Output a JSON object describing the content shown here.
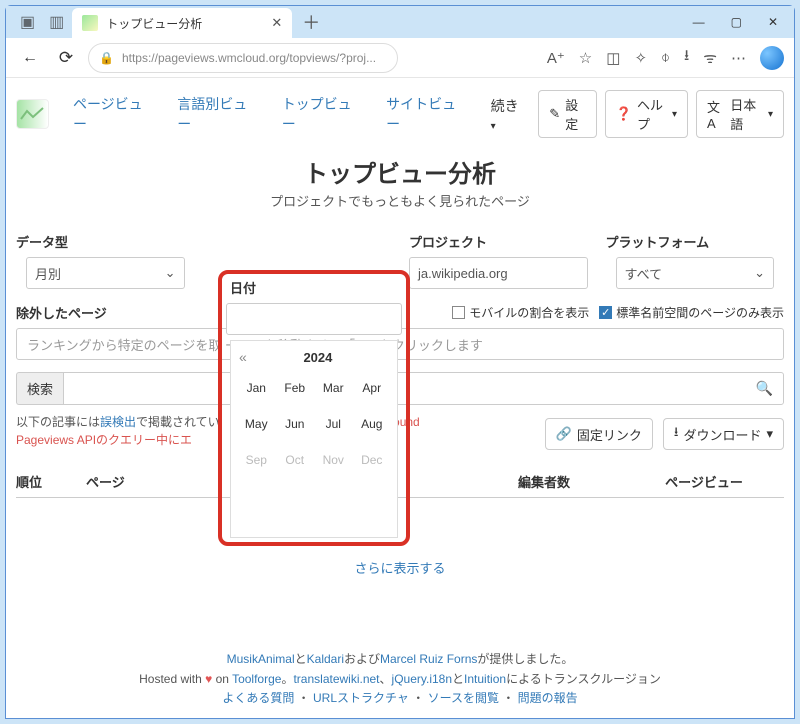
{
  "browser": {
    "tab_title": "トップビュー分析",
    "url": "https://pageviews.wmcloud.org/topviews/?proj...",
    "newtab": "＋",
    "win": {
      "min": "—",
      "max": "▢",
      "close": "✕"
    }
  },
  "nav": {
    "pageviews": "ページビュー",
    "langviews": "言語別ビュー",
    "topviews": "トップビュー",
    "siteviews": "サイトビュー",
    "continue": "続き",
    "settings": "設定",
    "help": "ヘルプ",
    "lang": "日本語"
  },
  "page": {
    "title": "トップビュー分析",
    "subtitle": "プロジェクトでもっともよく見られたページ"
  },
  "form": {
    "datatype_label": "データ型",
    "datatype_value": "月別",
    "date_label": "日付",
    "project_label": "プロジェクト",
    "project_value": "ja.wikipedia.org",
    "platform_label": "プラットフォーム",
    "platform_value": "すべて",
    "excluded_label": "除外したページ",
    "mobile_chk": "モバイルの割合を表示",
    "mainns_chk": "標準名前空間のページのみ表示",
    "excluded_placeholder": "ランキングから特定のページを取                                      ーソルを移動させて「✕」をクリックします",
    "search_label": "検索",
    "note_prefix": "以下の記事には",
    "note_link": "誤検出",
    "note_suffix_1": "で掲載されてい",
    "note_suffix_2": "ound",
    "error": "Pageviews APIのクエリー中にエ",
    "perm": "固定リンク",
    "download": "ダウンロード"
  },
  "table": {
    "rank": "順位",
    "page": "ページ",
    "editors": "編集者数",
    "views": "ページビュー",
    "more": "さらに表示する"
  },
  "datepicker": {
    "year": "2024",
    "months_enabled": [
      "Jan",
      "Feb",
      "Mar",
      "Apr",
      "May",
      "Jun",
      "Jul",
      "Aug"
    ],
    "months_disabled": [
      "Sep",
      "Oct",
      "Nov",
      "Dec"
    ]
  },
  "footer": {
    "l1a": "MusikAnimal",
    "l1b": "と",
    "l1c": "Kaldari",
    "l1d": "および",
    "l1e": "Marcel Ruiz Forns",
    "l1f": "が提供しました。",
    "l2a": "Hosted with ",
    "l2b": " on ",
    "l2c": "Toolforge",
    "l2d": "。",
    "l2e": "translatewiki.net",
    "l2f": "、",
    "l2g": "jQuery.i18n",
    "l2h": "と",
    "l2i": "Intuition",
    "l2j": "によるトランスクルージョン",
    "l3a": "よくある質問",
    "l3s": " ・ ",
    "l3b": "URLストラクチャ",
    "l3c": "ソースを閲覧",
    "l3d": "問題の報告"
  }
}
